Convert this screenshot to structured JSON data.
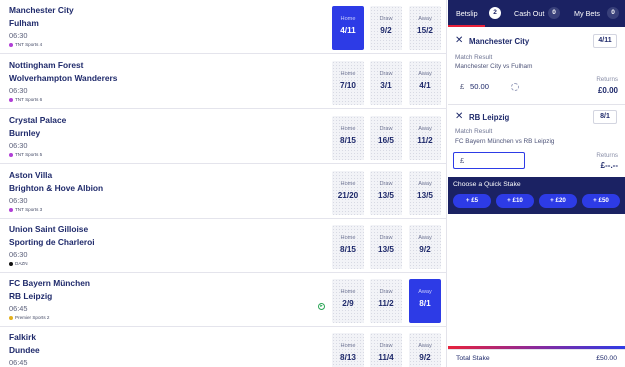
{
  "matches": [
    {
      "home": "Manchester City",
      "away": "Fulham",
      "time": "06:30",
      "channel": "TNT Sports 4",
      "channel_color": "#b13fd6",
      "odds": [
        {
          "label": "Home",
          "value": "4/11",
          "selected": true
        },
        {
          "label": "Draw",
          "value": "9/2",
          "selected": false
        },
        {
          "label": "Away",
          "value": "15/2",
          "selected": false
        }
      ]
    },
    {
      "home": "Nottingham Forest",
      "away": "Wolverhampton Wanderers",
      "time": "06:30",
      "channel": "TNT Sports 6",
      "channel_color": "#b13fd6",
      "odds": [
        {
          "label": "Home",
          "value": "7/10",
          "selected": false
        },
        {
          "label": "Draw",
          "value": "3/1",
          "selected": false
        },
        {
          "label": "Away",
          "value": "4/1",
          "selected": false
        }
      ]
    },
    {
      "home": "Crystal Palace",
      "away": "Burnley",
      "time": "06:30",
      "channel": "TNT Sports 5",
      "channel_color": "#b13fd6",
      "odds": [
        {
          "label": "Home",
          "value": "8/15",
          "selected": false
        },
        {
          "label": "Draw",
          "value": "16/5",
          "selected": false
        },
        {
          "label": "Away",
          "value": "11/2",
          "selected": false
        }
      ]
    },
    {
      "home": "Aston Villa",
      "away": "Brighton & Hove Albion",
      "time": "06:30",
      "channel": "TNT Sports 3",
      "channel_color": "#b13fd6",
      "odds": [
        {
          "label": "Home",
          "value": "21/20",
          "selected": false
        },
        {
          "label": "Draw",
          "value": "13/5",
          "selected": false
        },
        {
          "label": "Away",
          "value": "13/5",
          "selected": false
        }
      ]
    },
    {
      "home": "Union Saint Gilloise",
      "away": "Sporting de Charleroi",
      "time": "06:30",
      "channel": "DAZN",
      "channel_color": "#111111",
      "odds": [
        {
          "label": "Home",
          "value": "8/15",
          "selected": false
        },
        {
          "label": "Draw",
          "value": "13/5",
          "selected": false
        },
        {
          "label": "Away",
          "value": "9/2",
          "selected": false
        }
      ]
    },
    {
      "home": "FC Bayern München",
      "away": "RB Leipzig",
      "time": "06:45",
      "channel": "Premier Sports 2",
      "channel_color": "#e3b11e",
      "odds": [
        {
          "label": "Home",
          "value": "2/9",
          "selected": false
        },
        {
          "label": "Draw",
          "value": "11/2",
          "selected": false
        },
        {
          "label": "Away",
          "value": "8/1",
          "selected": true
        }
      ]
    },
    {
      "home": "Falkirk",
      "away": "Dundee",
      "time": "06:45",
      "channel": "",
      "channel_color": "",
      "odds": [
        {
          "label": "Home",
          "value": "8/13",
          "selected": false
        },
        {
          "label": "Draw",
          "value": "11/4",
          "selected": false
        },
        {
          "label": "Away",
          "value": "9/2",
          "selected": false
        }
      ]
    }
  ],
  "betslip": {
    "tabs": [
      {
        "label": "Betslip",
        "count": "2",
        "active": true
      },
      {
        "label": "Cash Out",
        "count": "0",
        "active": false
      },
      {
        "label": "My Bets",
        "count": "0",
        "active": false
      }
    ],
    "bets": [
      {
        "selection": "Manchester City",
        "odds": "4/11",
        "market": "Match Result",
        "event": "Manchester City vs Fulham",
        "currency": "£",
        "stake": "50.00",
        "returns_label": "Returns",
        "returns": "£0.00"
      },
      {
        "selection": "RB Leipzig",
        "odds": "8/1",
        "market": "Match Result",
        "event": "FC Bayern München vs RB Leipzig",
        "currency": "£",
        "stake": "",
        "returns_label": "Returns",
        "returns": "£--.--"
      }
    ],
    "quick_stake": {
      "title": "Choose a Quick Stake",
      "options": [
        "+ £5",
        "+ £10",
        "+ £20",
        "+ £50"
      ]
    },
    "total_label": "Total Stake",
    "total_value": "£50.00"
  },
  "icons": {
    "close": "close-icon",
    "inplay": "play-icon",
    "refresh": "refresh-icon"
  },
  "colors": {
    "navy": "#1b2263",
    "accent": "#2d3be6",
    "highlight": "#e8213b"
  }
}
